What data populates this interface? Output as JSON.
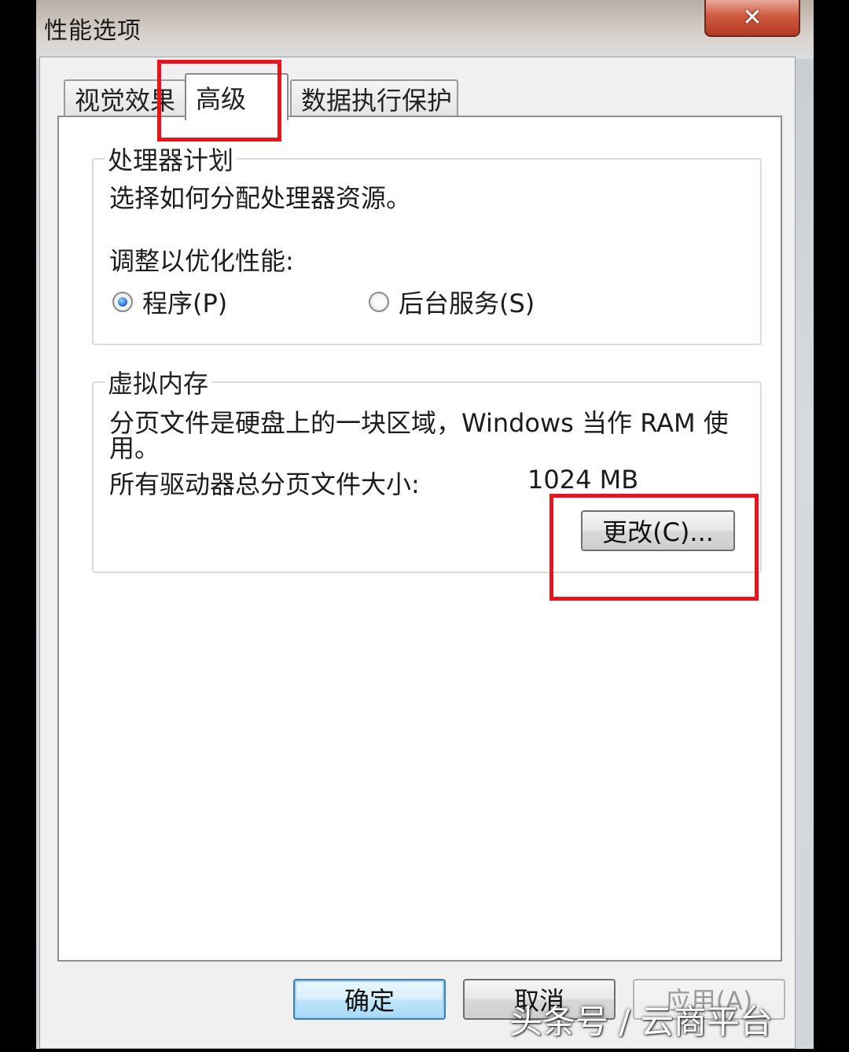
{
  "window": {
    "title": "性能选项",
    "close_glyph": "✕"
  },
  "tabs": [
    {
      "label": "视觉效果",
      "active": false
    },
    {
      "label": "高级",
      "active": true
    },
    {
      "label": "数据执行保护",
      "active": false
    }
  ],
  "processor": {
    "group_title": "处理器计划",
    "description": "选择如何分配处理器资源。",
    "adjust_label": "调整以优化性能:",
    "options": [
      {
        "label": "程序(P)",
        "selected": true
      },
      {
        "label": "后台服务(S)",
        "selected": false
      }
    ]
  },
  "virtual_memory": {
    "group_title": "虚拟内存",
    "description_line1": "分页文件是硬盘上的一块区域，Windows 当作 RAM 使",
    "description_line2": "用。",
    "total_label": "所有驱动器总分页文件大小:",
    "total_value": "1024 MB",
    "change_button": "更改(C)..."
  },
  "footer": {
    "ok": "确定",
    "cancel": "取消",
    "apply": "应用(A)"
  },
  "watermark": "头条号 / 云商平台",
  "colors": {
    "highlight_box": "#e8141b",
    "radio_selected": "#2a7bd6",
    "default_button_border": "#3c7fb1"
  }
}
